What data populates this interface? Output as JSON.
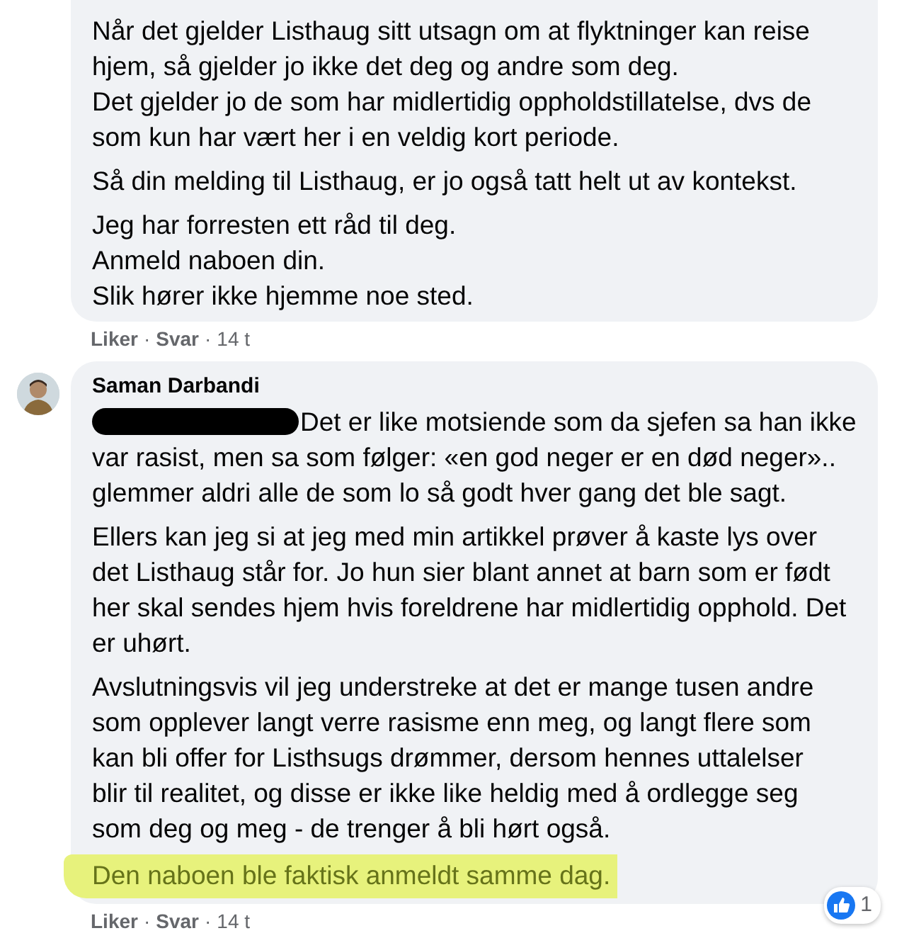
{
  "comments": [
    {
      "avatar": false,
      "paragraphs": [
        {
          "lines": [
            "Når det gjelder Listhaug sitt utsagn om at flyktninger kan reise",
            "hjem, så gjelder jo ikke det deg og andre som deg.",
            "Det gjelder jo de som har midlertidig oppholdstillatelse, dvs de",
            "som kun har vært her i en veldig kort periode."
          ],
          "redacted": false,
          "highlighted": false
        },
        {
          "lines": [
            "Så din melding til Listhaug, er jo også tatt helt ut av kontekst."
          ],
          "redacted": false,
          "highlighted": false
        },
        {
          "lines": [
            "Jeg har forresten ett råd til deg.",
            "Anmeld naboen din.",
            "Slik hører ikke hjemme noe sted."
          ],
          "redacted": false,
          "highlighted": false
        }
      ],
      "actions": [
        {
          "label": "Liker",
          "kind": "link"
        },
        {
          "label": "Svar",
          "kind": "link"
        },
        {
          "label": "14 t",
          "kind": "time"
        }
      ]
    },
    {
      "author": "Saman Darbandi",
      "avatar": true,
      "paragraphs": [
        {
          "lines": [
            "Det er like motsiende som da sjefen sa han ikke",
            "var rasist, men sa som følger: «en god neger er en død neger»..",
            "glemmer aldri alle de som lo så godt hver gang det ble sagt."
          ],
          "redacted": true,
          "highlighted": false
        },
        {
          "lines": [
            "Ellers kan jeg si at jeg med min artikkel prøver å kaste lys over",
            "det Listhaug står for. Jo hun sier blant annet at barn som er født",
            "her skal sendes hjem hvis foreldrene har midlertidig opphold. Det",
            "er uhørt."
          ],
          "redacted": false,
          "highlighted": false
        },
        {
          "lines": [
            "Avslutningsvis vil jeg understreke at det er mange tusen andre",
            "som opplever langt verre rasisme enn meg, og langt flere som",
            "kan bli offer for Listhsugs drømmer, dersom hennes uttalelser",
            "blir til realitet, og disse er ikke like heldig med å ordlegge seg",
            "som deg og meg - de trenger å bli hørt også."
          ],
          "redacted": false,
          "highlighted": false
        },
        {
          "lines": [
            "Den naboen ble faktisk anmeldt samme dag."
          ],
          "redacted": false,
          "highlighted": true
        }
      ],
      "actions": [
        {
          "label": "Liker",
          "kind": "link"
        },
        {
          "label": "Svar",
          "kind": "link"
        },
        {
          "label": "14 t",
          "kind": "time"
        }
      ],
      "reactions": {
        "count": "1"
      }
    }
  ],
  "separator": "·"
}
